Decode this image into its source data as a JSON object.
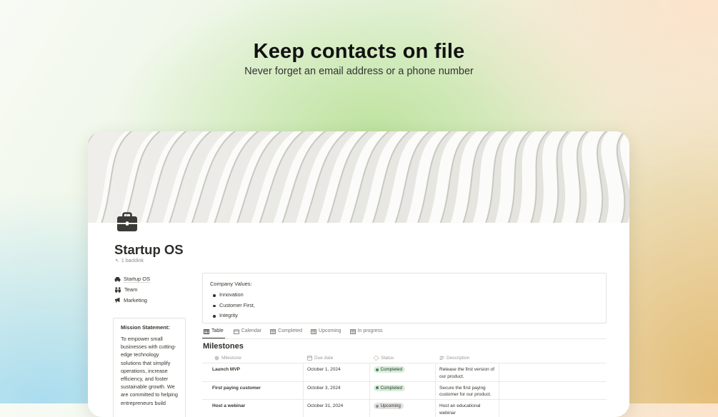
{
  "hero": {
    "title": "Keep contacts on file",
    "subtitle": "Never forget an email address or a phone number"
  },
  "page": {
    "icon": "briefcase-icon",
    "title": "Startup OS",
    "backlinks": "1 backlink"
  },
  "nav": {
    "items": [
      {
        "label": "Startup OS",
        "icon": "car-icon"
      },
      {
        "label": "Team",
        "icon": "people-icon"
      },
      {
        "label": "Marketing",
        "icon": "megaphone-icon"
      }
    ]
  },
  "mission": {
    "title": "Mission Statement:",
    "text": "To empower small businesses with cutting-edge technology solutions that simplify operations, increase efficiency, and foster sustainable growth. We are committed to helping entrepreneurs build"
  },
  "values": {
    "title": "Company Values:",
    "items": [
      "Innovation",
      "Customer First,",
      "Integrity"
    ]
  },
  "tabs": [
    {
      "label": "Table",
      "icon": "table-icon",
      "active": true
    },
    {
      "label": "Calendar",
      "icon": "calendar-icon",
      "active": false
    },
    {
      "label": "Completed",
      "icon": "table-icon",
      "active": false
    },
    {
      "label": "Upcoming",
      "icon": "table-icon",
      "active": false
    },
    {
      "label": "In progress",
      "icon": "table-icon",
      "active": false
    }
  ],
  "milestones": {
    "title": "Milestones",
    "columns": [
      "Milestone",
      "Due date",
      "Status",
      "Description"
    ],
    "rows": [
      {
        "name": "Launch MVP",
        "due": "October 1, 2024",
        "status": "Completed",
        "description": "Release the first version of our product."
      },
      {
        "name": "First paying customer",
        "due": "October 3, 2024",
        "status": "Completed",
        "description": "Secure the first paying customer for our product."
      },
      {
        "name": "Host a webinar",
        "due": "October 31, 2024",
        "status": "Upcoming",
        "description": "Host an educational webinar"
      }
    ]
  },
  "colors": {
    "status_completed_bg": "#dbeddb",
    "status_completed_dot": "#448361",
    "status_upcoming_bg": "#e3e2e0"
  }
}
